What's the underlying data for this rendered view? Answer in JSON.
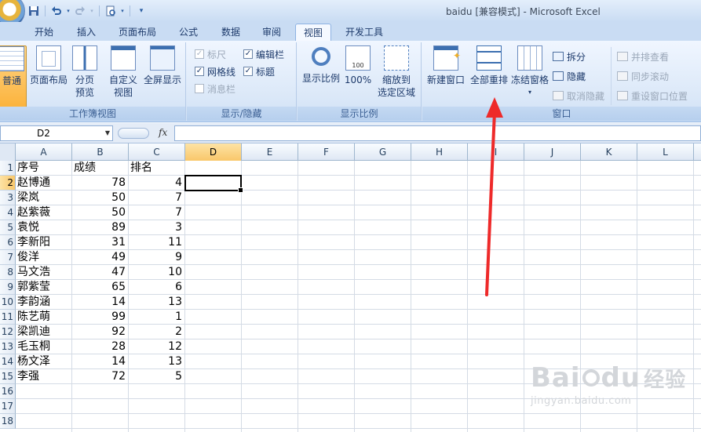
{
  "window": {
    "title": "baidu  [兼容模式] - Microsoft Excel"
  },
  "quick_access": {
    "icons": [
      "save-icon",
      "undo-icon",
      "redo-icon",
      "print-preview-icon",
      "customize-icon"
    ]
  },
  "tabs": [
    {
      "label": "开始",
      "active": false
    },
    {
      "label": "插入",
      "active": false
    },
    {
      "label": "页面布局",
      "active": false
    },
    {
      "label": "公式",
      "active": false
    },
    {
      "label": "数据",
      "active": false
    },
    {
      "label": "审阅",
      "active": false
    },
    {
      "label": "视图",
      "active": true
    },
    {
      "label": "开发工具",
      "active": false
    }
  ],
  "ribbon": {
    "workbook_views": {
      "label": "工作簿视图",
      "normal": "普通",
      "page_layout": "页面布局",
      "page_break_line1": "分页",
      "page_break_line2": "预览",
      "custom_line1": "自定义",
      "custom_line2": "视图",
      "full_screen": "全屏显示"
    },
    "show_hide": {
      "label": "显示/隐藏",
      "ruler": "标尺",
      "gridlines": "网格线",
      "message_bar": "消息栏",
      "formula_bar": "编辑栏",
      "headings": "标题",
      "ruler_checked": true,
      "gridlines_checked": true,
      "message_bar_checked": false,
      "formula_bar_checked": true,
      "headings_checked": true
    },
    "zoom": {
      "label": "显示比例",
      "zoom": "显示比例",
      "hundred": "100%",
      "hundred_icon_text": "100",
      "zoom_sel_line1": "缩放到",
      "zoom_sel_line2": "选定区域"
    },
    "window": {
      "label": "窗口",
      "new_window": "新建窗口",
      "arrange_all": "全部重排",
      "freeze": "冻结窗格",
      "freeze_arrow": "▾",
      "split": "拆分",
      "hide": "隐藏",
      "unhide": "取消隐藏",
      "side_by_side": "并排查看",
      "sync_scroll": "同步滚动",
      "reset_pos": "重设窗口位置"
    }
  },
  "formula_bar": {
    "name_box": "D2",
    "fx": "fx",
    "formula": ""
  },
  "grid": {
    "columns": [
      "A",
      "B",
      "C",
      "D",
      "E",
      "F",
      "G",
      "H",
      "I",
      "J",
      "K",
      "L"
    ],
    "selected_column": "D",
    "rows": [
      "1",
      "2",
      "3",
      "4",
      "5",
      "6",
      "7",
      "8",
      "9",
      "10",
      "11",
      "12",
      "13",
      "14",
      "15",
      "16",
      "17",
      "18"
    ],
    "selected_row": "2",
    "active_cell": "D2",
    "header_row": [
      "序号",
      "成绩",
      "排名"
    ],
    "data": [
      [
        "赵博通",
        "78",
        "4"
      ],
      [
        "梁岚",
        "50",
        "7"
      ],
      [
        "赵紫薇",
        "50",
        "7"
      ],
      [
        "袁悦",
        "89",
        "3"
      ],
      [
        "李新阳",
        "31",
        "11"
      ],
      [
        "俊洋",
        "49",
        "9"
      ],
      [
        "马文浩",
        "47",
        "10"
      ],
      [
        "郭紫莹",
        "65",
        "6"
      ],
      [
        "李韵涵",
        "14",
        "13"
      ],
      [
        "陈艺萌",
        "99",
        "1"
      ],
      [
        "梁凯迪",
        "92",
        "2"
      ],
      [
        "毛玉桐",
        "28",
        "12"
      ],
      [
        "杨文泽",
        "14",
        "13"
      ],
      [
        "李强",
        "72",
        "5"
      ]
    ]
  },
  "annotation": {
    "arrow_color": "#ee2a2a"
  },
  "watermark": {
    "main_text_1": "Bai",
    "main_text_2": "du",
    "main_text_3": "经验",
    "sub_text": "jingyan.baidu.com"
  }
}
